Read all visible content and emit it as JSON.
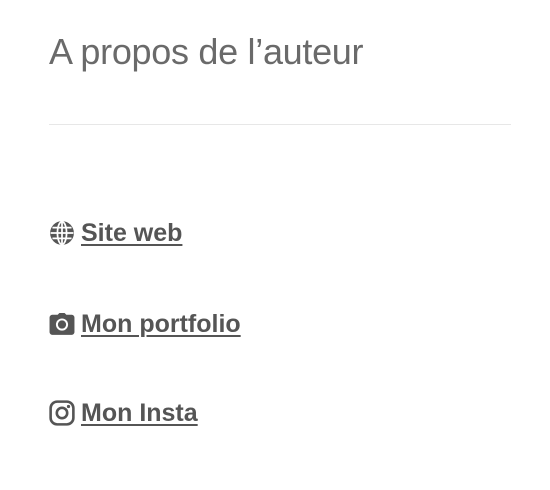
{
  "widget": {
    "title": "A propos de l’auteur",
    "links": [
      {
        "icon": "globe-icon",
        "label": "Site web"
      },
      {
        "icon": "camera-icon",
        "label": "Mon portfolio"
      },
      {
        "icon": "instagram-icon",
        "label": "Mon Insta"
      }
    ]
  },
  "colors": {
    "text": "#555555",
    "title": "#6a6a6a",
    "divider": "#e7e7e7"
  }
}
